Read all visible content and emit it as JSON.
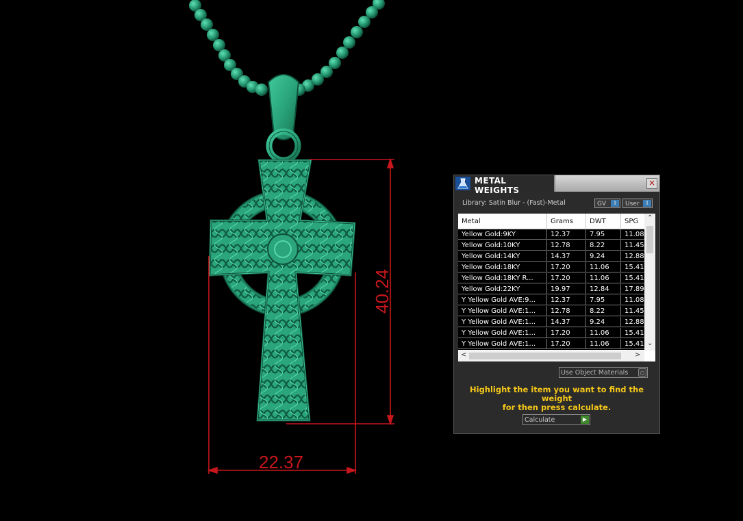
{
  "viewport": {
    "object": "celtic-cross-pendant",
    "dimension_width": "22.37",
    "dimension_height": "40.24",
    "dimension_color": "#c8171c",
    "model_color": "#2fae86"
  },
  "panel": {
    "title": "METAL WEIGHTS",
    "close_icon": "×",
    "library_label": "Library: Satin Blur - (Fast)-Metal",
    "toggle_gv": "GV",
    "toggle_user": "User",
    "columns": [
      "Metal",
      "Grams",
      "DWT",
      "SPG"
    ],
    "rows": [
      [
        "Yellow Gold:9KY",
        "12.37",
        "7.95",
        "11.08"
      ],
      [
        "Yellow Gold:10KY",
        "12.78",
        "8.22",
        "11.45"
      ],
      [
        "Yellow Gold:14KY",
        "14.37",
        "9.24",
        "12.88"
      ],
      [
        "Yellow Gold:18KY",
        "17.20",
        "11.06",
        "15.41"
      ],
      [
        "Yellow Gold:18KY R...",
        "17.20",
        "11.06",
        "15.41"
      ],
      [
        "Yellow Gold:22KY",
        "19.97",
        "12.84",
        "17.89"
      ],
      [
        "Y Yellow Gold AVE:9...",
        "12.37",
        "7.95",
        "11.08"
      ],
      [
        "Y Yellow Gold AVE:1...",
        "12.78",
        "8.22",
        "11.45"
      ],
      [
        "Y Yellow Gold AVE:1...",
        "14.37",
        "9.24",
        "12.88"
      ],
      [
        "Y Yellow Gold AVE:1...",
        "17.20",
        "11.06",
        "15.41"
      ],
      [
        "Y Yellow Gold AVE:1...",
        "17.20",
        "11.06",
        "15.41"
      ]
    ],
    "use_object_materials": "Use Object Materials",
    "instruction_line1": "Highlight the item you want to find the weight",
    "instruction_line2": "for then press calculate.",
    "calculate_label": "Calculate",
    "accent_yellow": "#f5c71a"
  }
}
